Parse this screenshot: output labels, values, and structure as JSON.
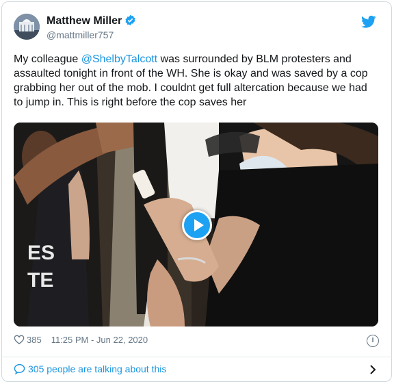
{
  "author": {
    "display_name": "Matthew Miller",
    "handle": "@mattmiller757"
  },
  "tweet": {
    "text_1": "My colleague ",
    "mention": "@ShelbyTalcott",
    "text_2": " was surrounded by BLM protesters and assaulted tonight in front of the WH. She is okay and was saved by a cop grabbing her out of the mob. I couldnt get full altercation because we had to jump in. This is right before the cop saves her"
  },
  "media": {
    "shirt_text_1": "ES",
    "shirt_text_2": "TE"
  },
  "meta": {
    "like_count": "385",
    "timestamp": "11:25 PM - Jun 22, 2020",
    "info_glyph": "i"
  },
  "footer": {
    "talking": "305 people are talking about this"
  },
  "colors": {
    "accent": "#1da1f2",
    "link": "#1b95e0",
    "muted": "#657786"
  },
  "icons": [
    "verified-badge-icon",
    "twitter-bird-icon",
    "play-icon",
    "heart-icon",
    "info-icon",
    "speech-bubble-icon",
    "chevron-right-icon"
  ]
}
